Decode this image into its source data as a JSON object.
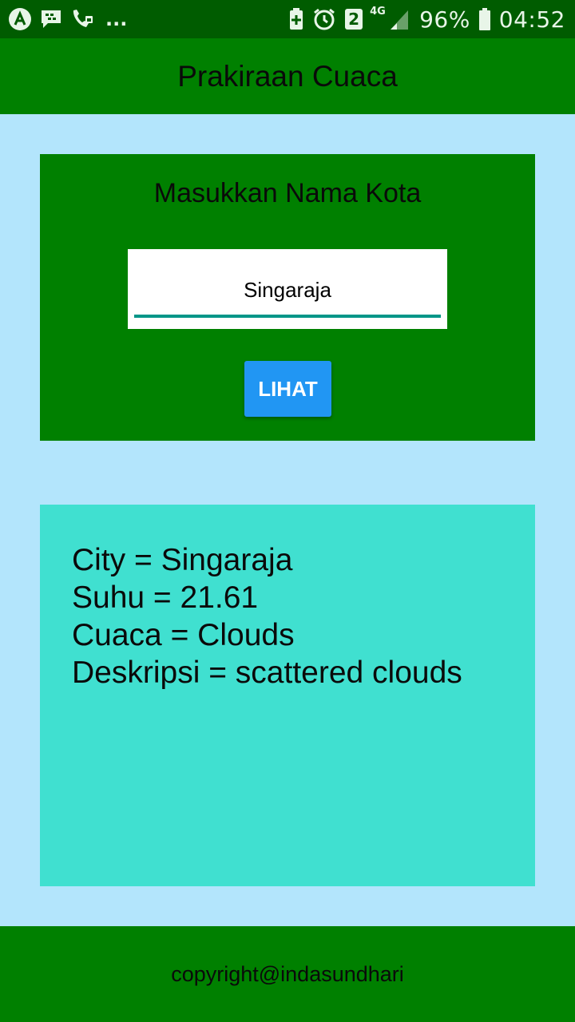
{
  "status_bar": {
    "overflow": "...",
    "notif_count": "2",
    "network": "4G",
    "battery": "96%",
    "time": "04:52",
    "icons": [
      "app-icon",
      "bbm-icon",
      "call-icon",
      "battery-saver-icon",
      "alarm-icon",
      "sim-icon",
      "signal-icon",
      "battery-icon"
    ]
  },
  "app_bar": {
    "title": "Prakiraan Cuaca"
  },
  "input_card": {
    "title": "Masukkan Nama Kota",
    "city_value": "Singaraja",
    "button_label": "LIHAT"
  },
  "result": {
    "city": "City = Singaraja",
    "temp": "Suhu = 21.61",
    "weather": "Cuaca = Clouds",
    "description": "Deskripsi = scattered clouds"
  },
  "footer": {
    "text": "copyright@indasundhari"
  },
  "colors": {
    "status_bar": "#005c00",
    "primary": "#008000",
    "background": "#b3e5fc",
    "result_bg": "#40e0d0",
    "button": "#2196f3",
    "input_underline": "#009688"
  }
}
